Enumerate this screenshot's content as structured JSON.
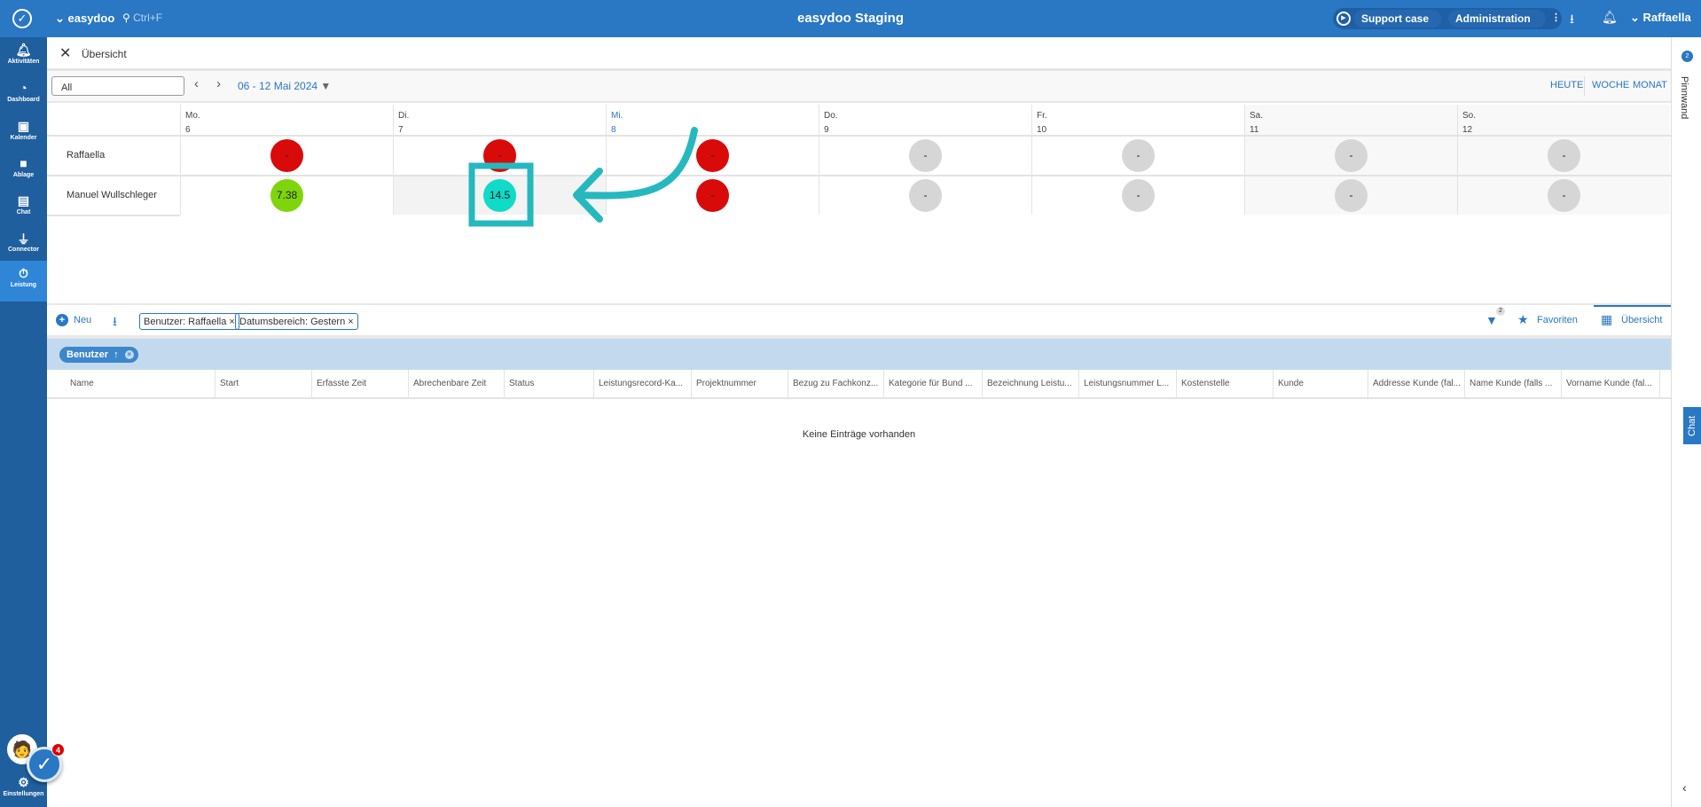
{
  "topbar": {
    "app": "easydoo",
    "search": "Ctrl+F",
    "title": "easydoo Staging",
    "support": "Support case",
    "admin": "Administration",
    "user": "Raffaella"
  },
  "sidebar": {
    "items": [
      {
        "label": "Aktivitäten",
        "icon": "bell-icon"
      },
      {
        "label": "Dashboard",
        "icon": "gauge-icon"
      },
      {
        "label": "Kalender",
        "icon": "calendar-icon"
      },
      {
        "label": "Ablage",
        "icon": "folder-icon"
      },
      {
        "label": "Chat",
        "icon": "chat-icon"
      },
      {
        "label": "Connector",
        "icon": "plug-icon"
      },
      {
        "label": "Leistung",
        "icon": "stopwatch-icon",
        "active": true
      }
    ],
    "settings": "Einstellungen",
    "badge": "4"
  },
  "header": {
    "title": "Übersicht"
  },
  "toolbar": {
    "filter": "All",
    "range": "06 - 12 Mai 2024",
    "views": [
      "HEUTE",
      "WOCHE",
      "MONAT"
    ]
  },
  "days": [
    {
      "d": "Mo.",
      "n": "6"
    },
    {
      "d": "Di.",
      "n": "7"
    },
    {
      "d": "Mi.",
      "n": "8"
    },
    {
      "d": "Do.",
      "n": "9"
    },
    {
      "d": "Fr.",
      "n": "10"
    },
    {
      "d": "Sa.",
      "n": "11"
    },
    {
      "d": "So.",
      "n": "12"
    }
  ],
  "rows": [
    {
      "name": "Raffaella",
      "cells": [
        {
          "v": "-",
          "s": "red"
        },
        {
          "v": "-",
          "s": "red"
        },
        {
          "v": "-",
          "s": "red"
        },
        {
          "v": "-",
          "s": "gray"
        },
        {
          "v": "-",
          "s": "gray"
        },
        {
          "v": "-",
          "s": "gray"
        },
        {
          "v": "-",
          "s": "gray"
        }
      ]
    },
    {
      "name": "Manuel Wullschleger",
      "cells": [
        {
          "v": "7.38",
          "s": "green"
        },
        {
          "v": "14.5",
          "s": "teal"
        },
        {
          "v": "-",
          "s": "red"
        },
        {
          "v": "-",
          "s": "gray"
        },
        {
          "v": "-",
          "s": "gray"
        },
        {
          "v": "-",
          "s": "gray"
        },
        {
          "v": "-",
          "s": "gray"
        }
      ]
    }
  ],
  "list": {
    "new": "Neu",
    "chips": [
      "Benutzer: Raffaella",
      "Datumsbereich: Gestern"
    ],
    "filter_count": "2",
    "favorites": "Favoriten",
    "overview": "Übersicht",
    "group": "Benutzer",
    "columns": [
      "Name",
      "Start",
      "Erfasste Zeit",
      "Abrechenbare Zeit",
      "Status",
      "Leistungsrecord-Ka...",
      "Projektnummer",
      "Bezug zu Fachkonz...",
      "Kategorie für Bund ...",
      "Bezeichnung Leistu...",
      "Leistungsnummer L...",
      "Kostenstelle",
      "Kunde",
      "Addresse Kunde (fal...",
      "Name Kunde (falls ...",
      "Vorname Kunde (fal..."
    ],
    "empty": "Keine Einträge vorhanden"
  },
  "rightpanel": {
    "pinnwand": "Pinnwand",
    "pin_count": "2",
    "chat": "Chat"
  },
  "colors": {
    "accent": "#2a77c4",
    "red": "#d90a0a",
    "green": "#7ed50c",
    "teal": "#10dac8",
    "gray": "#d6d6d6",
    "annotation": "#26b8bf"
  }
}
